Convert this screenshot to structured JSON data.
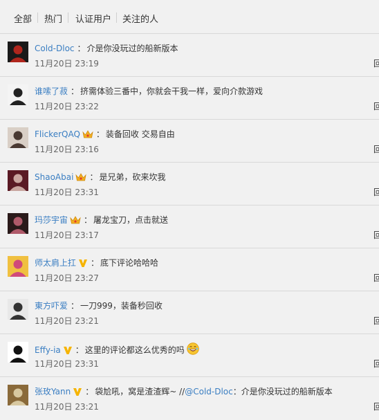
{
  "tabs": [
    "全部",
    "热门",
    "认证用户",
    "关注的人"
  ],
  "comments": [
    {
      "user": "Cold-Dloc",
      "badge": "none",
      "text": "介是你没玩过的船新版本",
      "time": "11月20日 23:19",
      "reply": "回",
      "avatar_colors": [
        "#1a1a1a",
        "#b0261d"
      ]
    },
    {
      "user": "谁嗦了菽",
      "badge": "none",
      "text": "挤需体验三番中，你就会干我一样，爱向介款游戏",
      "time": "11月20日 23:22",
      "reply": "回",
      "avatar_colors": [
        "#f4f4f4",
        "#222222"
      ]
    },
    {
      "user": "FlickerQAQ",
      "badge": "crown",
      "text": "装备回收 交易自由",
      "time": "11月20日 23:16",
      "reply": "回",
      "avatar_colors": [
        "#d9cfc6",
        "#4a3a33"
      ]
    },
    {
      "user": "ShaoAbai",
      "badge": "crown",
      "text": "是兄弟，砍来坎我",
      "time": "11月20日 23:31",
      "reply": "回",
      "avatar_colors": [
        "#5a1a24",
        "#c9a6a0"
      ]
    },
    {
      "user": "玛莎宇宙",
      "badge": "crown",
      "text": "屠龙宝刀，点击就送",
      "time": "11月20日 23:17",
      "reply": "回",
      "avatar_colors": [
        "#2a1a1a",
        "#b05a6a"
      ]
    },
    {
      "user": "师太肩上扛",
      "badge": "vip",
      "text": "底下评论哈哈哈",
      "time": "11月20日 23:27",
      "reply": "回",
      "avatar_colors": [
        "#f0c040",
        "#d04a7a"
      ]
    },
    {
      "user": "東方吓爱",
      "badge": "none",
      "text": "一刀999，装备秒回收",
      "time": "11月20日 23:21",
      "reply": "回",
      "avatar_colors": [
        "#e8e8e8",
        "#333333"
      ]
    },
    {
      "user": "Effy-ia",
      "badge": "vip",
      "text": "这里的评论都这么优秀的吗",
      "emoji": "laugh",
      "time": "11月20日 23:31",
      "reply": "回",
      "avatar_colors": [
        "#ffffff",
        "#111111"
      ]
    },
    {
      "user": "张玫Yann",
      "badge": "vip",
      "text_prefix": "袋尬吼，窝是渣渣辉~ //",
      "mention": "@Cold-Dloc",
      "text_suffix": "：介是你没玩过的船新版本",
      "time": "11月20日 23:21",
      "reply": "回",
      "avatar_colors": [
        "#8a6a3a",
        "#d8c8a0"
      ]
    }
  ],
  "colon": "："
}
